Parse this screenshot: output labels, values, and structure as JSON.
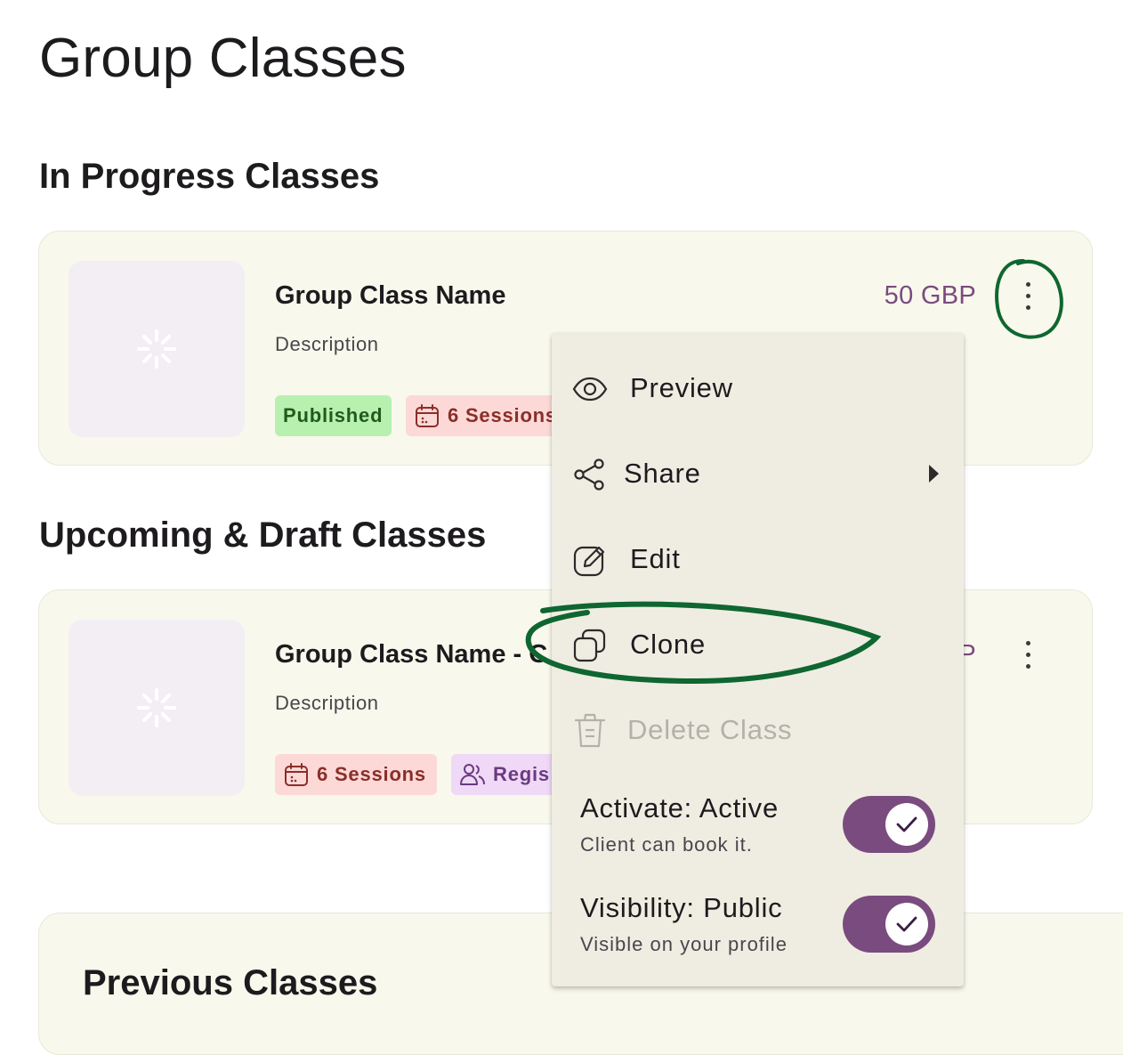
{
  "page": {
    "title": "Group Classes"
  },
  "sections": {
    "in_progress": "In Progress Classes",
    "upcoming": "Upcoming & Draft Classes",
    "previous": "Previous Classes"
  },
  "in_progress_card": {
    "name": "Group Class Name",
    "description": "Description",
    "status_chip": "Published",
    "sessions_chip": "6 Sessions",
    "price": "50 GBP"
  },
  "upcoming_card": {
    "name": "Group Class Name - C",
    "description": "Description",
    "sessions_chip": "6 Sessions",
    "registrations_chip": "Regis",
    "price_fragment": "P"
  },
  "menu": {
    "preview": "Preview",
    "share": "Share",
    "edit": "Edit",
    "clone": "Clone",
    "delete": "Delete Class",
    "activate": {
      "title": "Activate: Active",
      "subtitle": "Client can book it.",
      "checked": true
    },
    "visibility": {
      "title": "Visibility: Public",
      "subtitle": "Visible on your profile",
      "checked": true
    }
  },
  "icons": {
    "placeholder": "sparkle-placeholder-icon",
    "calendar": "calendar-icon",
    "users": "users-icon",
    "kebab": "more-vert-icon",
    "preview": "eye-icon",
    "share": "share-icon",
    "edit": "edit-icon",
    "clone": "copy-icon",
    "delete": "trash-icon",
    "check": "check-icon"
  },
  "colors": {
    "accent": "#7a4b7f",
    "card_bg": "#f8f8ec",
    "menu_bg": "#efede2",
    "published_bg": "#b8f0b0",
    "sessions_bg": "#fcd9d6",
    "registrations_bg": "#efd9f6",
    "annotation": "#0f6630"
  }
}
